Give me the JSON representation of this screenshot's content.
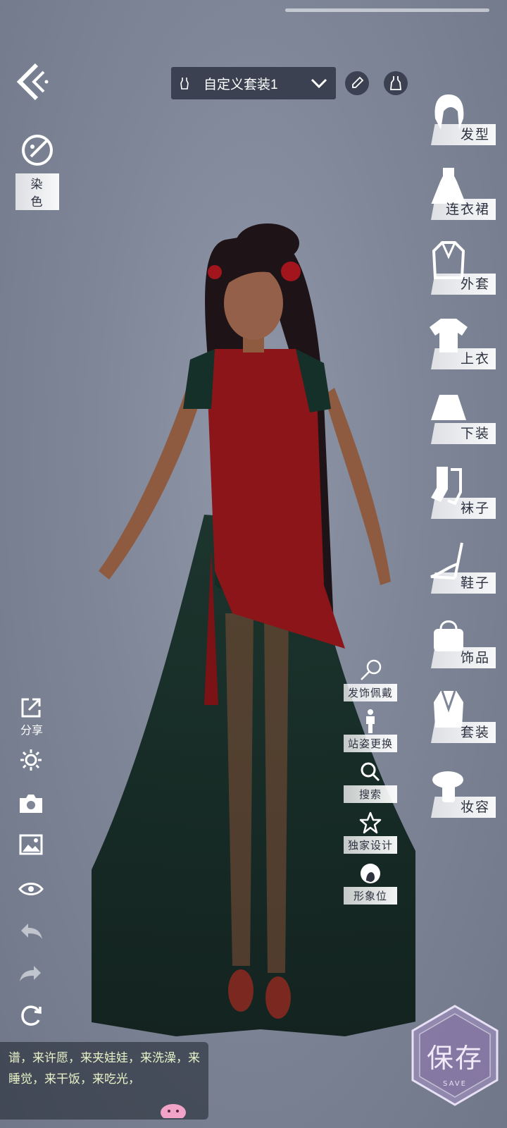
{
  "top": {
    "outfit_name": "自定义套装1"
  },
  "left_tools": {
    "dye_label": "染色",
    "share_label": "分享"
  },
  "categories": [
    {
      "label": "发型",
      "icon": "hair-icon"
    },
    {
      "label": "连衣裙",
      "icon": "dress-icon"
    },
    {
      "label": "外套",
      "icon": "coat-icon"
    },
    {
      "label": "上衣",
      "icon": "top-icon"
    },
    {
      "label": "下装",
      "icon": "skirt-icon"
    },
    {
      "label": "袜子",
      "icon": "socks-icon"
    },
    {
      "label": "鞋子",
      "icon": "shoe-icon"
    },
    {
      "label": "饰品",
      "icon": "bag-icon"
    },
    {
      "label": "套装",
      "icon": "suit-icon"
    },
    {
      "label": "妆容",
      "icon": "makeup-icon"
    }
  ],
  "middle_tools": [
    {
      "label": "发饰佩戴",
      "icon": "hair-ornament-icon"
    },
    {
      "label": "站姿更换",
      "icon": "pose-icon"
    },
    {
      "label": "搜索",
      "icon": "search-icon"
    },
    {
      "label": "独家设计",
      "icon": "star-icon"
    },
    {
      "label": "形象位",
      "icon": "portrait-icon"
    }
  ],
  "chat": {
    "message": "谱，来许愿，来夹娃娃，来洗澡，来睡觉，来干饭，来吃光，"
  },
  "save": {
    "label": "保存",
    "sub_label": "SAVE"
  },
  "colors": {
    "background": "#7e8698",
    "dropdown_bg": "#3b4150",
    "chat_text": "#e6f2c8"
  }
}
